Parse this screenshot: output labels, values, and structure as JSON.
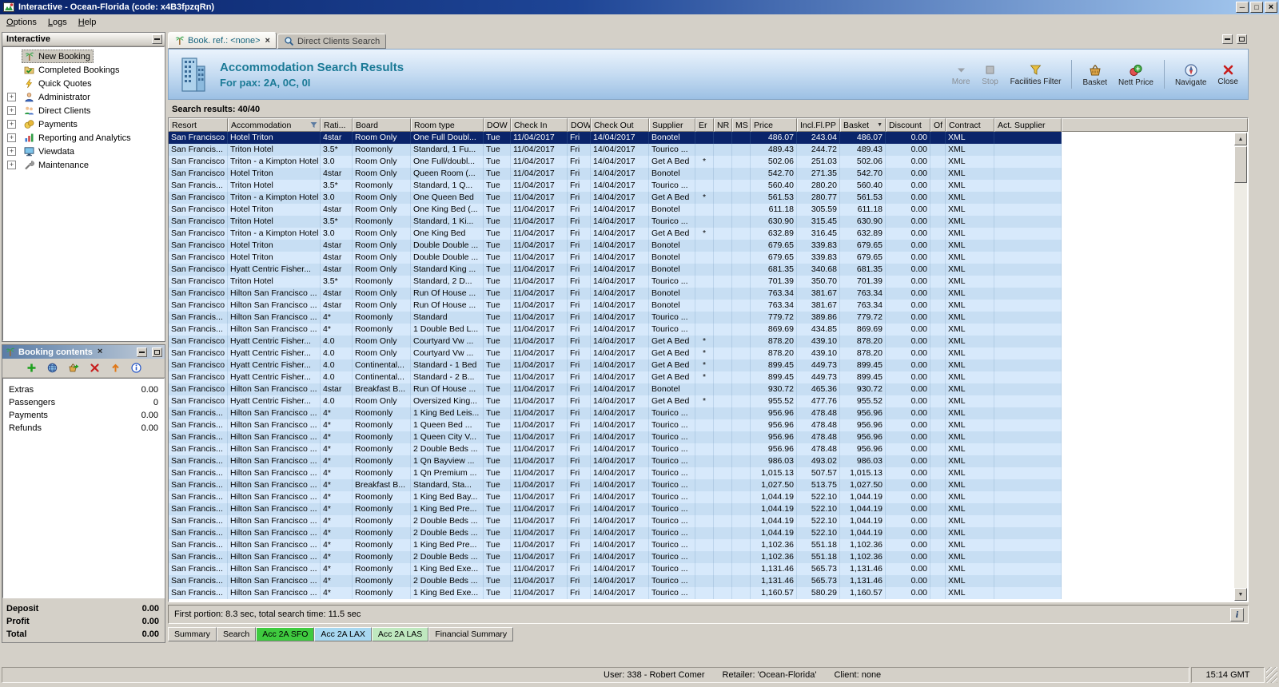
{
  "icons": {
    "minimize": "─",
    "maximize": "□",
    "close": "×",
    "close_small": "×",
    "info": "i",
    "sort_desc": "▼",
    "scroll_up": "▲",
    "scroll_down": "▼",
    "expander_plus": "+"
  },
  "window": {
    "title": "Interactive - Ocean-Florida (code: x4B3fpzqRn)",
    "menu": [
      "Options",
      "Logs",
      "Help"
    ]
  },
  "sidebar": {
    "title": "Interactive",
    "items": [
      {
        "label": "New Booking",
        "icon": "new-booking-icon",
        "selected": true,
        "expandable": false
      },
      {
        "label": "Completed Bookings",
        "icon": "completed-bookings-icon",
        "selected": false,
        "expandable": false
      },
      {
        "label": "Quick Quotes",
        "icon": "quick-quotes-icon",
        "selected": false,
        "expandable": false
      },
      {
        "label": "Administrator",
        "icon": "administrator-icon",
        "selected": false,
        "expandable": true
      },
      {
        "label": "Direct Clients",
        "icon": "direct-clients-icon",
        "selected": false,
        "expandable": true
      },
      {
        "label": "Payments",
        "icon": "payments-icon",
        "selected": false,
        "expandable": true
      },
      {
        "label": "Reporting and Analytics",
        "icon": "reporting-icon",
        "selected": false,
        "expandable": true
      },
      {
        "label": "Viewdata",
        "icon": "viewdata-icon",
        "selected": false,
        "expandable": true
      },
      {
        "label": "Maintenance",
        "icon": "maintenance-icon",
        "selected": false,
        "expandable": true
      }
    ]
  },
  "booking_contents": {
    "title": "Booking contents",
    "toolbar": [
      "add-icon",
      "globe-icon",
      "basket-add-icon",
      "remove-icon",
      "move-up-icon",
      "info-icon"
    ],
    "rows": [
      {
        "label": "Extras",
        "value": "0.00"
      },
      {
        "label": "Passengers",
        "value": "0"
      },
      {
        "label": "Payments",
        "value": "0.00"
      },
      {
        "label": "Refunds",
        "value": "0.00"
      }
    ],
    "totals": [
      {
        "label": "Deposit",
        "value": "0.00"
      },
      {
        "label": "Profit",
        "value": "0.00"
      },
      {
        "label": "Total",
        "value": "0.00"
      }
    ]
  },
  "document_tabs": [
    {
      "label": "Book. ref.: <none>",
      "icon": "palm-tree-icon",
      "active": true,
      "closable": true
    },
    {
      "label": "Direct Clients Search",
      "icon": "client-search-icon",
      "active": false,
      "closable": false
    }
  ],
  "header": {
    "title": "Accommodation Search Results",
    "subtitle": "For pax: 2A, 0C, 0I",
    "accent_color": "#1b7a96",
    "buttons": [
      {
        "label": "More",
        "icon": "more-icon",
        "disabled": true
      },
      {
        "label": "Stop",
        "icon": "stop-icon",
        "disabled": true
      },
      {
        "label": "Facilities Filter",
        "icon": "facilities-filter-icon",
        "disabled": false
      },
      {
        "separator": true
      },
      {
        "label": "Basket",
        "icon": "basket-icon",
        "disabled": false
      },
      {
        "label": "Nett Price",
        "icon": "nett-price-icon",
        "disabled": false
      },
      {
        "separator": true
      },
      {
        "label": "Navigate",
        "icon": "navigate-icon",
        "disabled": false
      },
      {
        "label": "Close",
        "icon": "close-red-icon",
        "disabled": false
      }
    ]
  },
  "results": {
    "summary": "Search results: 40/40",
    "status": "First portion: 8.3 sec, total search time: 11.5 sec",
    "selected_index": 0,
    "sorted_column": "Basket",
    "filtered_column": "Accommodation",
    "selected_row_color": "#0a246a",
    "row_color_a": "#d7e9fb",
    "row_color_b": "#c7def3",
    "columns": [
      "Resort",
      "Accommodation",
      "Rati...",
      "Board",
      "Room type",
      "DOW",
      "Check In",
      "DOW",
      "Check Out",
      "Supplier",
      "Er",
      "NR",
      "MS",
      "Price",
      "Incl.Fl.PP",
      "Basket",
      "Discount",
      "Of",
      "Contract",
      "Act. Supplier"
    ],
    "rows": [
      [
        "San Francisco",
        "Hotel Triton",
        "4star",
        "Room Only",
        "One Full Doubl...",
        "Tue",
        "11/04/2017",
        "Fri",
        "14/04/2017",
        "Bonotel",
        "",
        "",
        "",
        "486.07",
        "243.04",
        "486.07",
        "0.00",
        "",
        "XML",
        ""
      ],
      [
        "San Francis...",
        "Triton Hotel",
        "3.5*",
        "Roomonly",
        "Standard, 1 Fu...",
        "Tue",
        "11/04/2017",
        "Fri",
        "14/04/2017",
        "Tourico ...",
        "",
        "",
        "",
        "489.43",
        "244.72",
        "489.43",
        "0.00",
        "",
        "XML",
        ""
      ],
      [
        "San Francisco",
        "Triton - a Kimpton Hotel",
        "3.0",
        "Room Only",
        "One Full/doubl...",
        "Tue",
        "11/04/2017",
        "Fri",
        "14/04/2017",
        "Get A Bed",
        "*",
        "",
        "",
        "502.06",
        "251.03",
        "502.06",
        "0.00",
        "",
        "XML",
        ""
      ],
      [
        "San Francisco",
        "Hotel Triton",
        "4star",
        "Room Only",
        "Queen Room (...",
        "Tue",
        "11/04/2017",
        "Fri",
        "14/04/2017",
        "Bonotel",
        "",
        "",
        "",
        "542.70",
        "271.35",
        "542.70",
        "0.00",
        "",
        "XML",
        ""
      ],
      [
        "San Francis...",
        "Triton Hotel",
        "3.5*",
        "Roomonly",
        "Standard, 1 Q...",
        "Tue",
        "11/04/2017",
        "Fri",
        "14/04/2017",
        "Tourico ...",
        "",
        "",
        "",
        "560.40",
        "280.20",
        "560.40",
        "0.00",
        "",
        "XML",
        ""
      ],
      [
        "San Francisco",
        "Triton - a Kimpton Hotel",
        "3.0",
        "Room Only",
        "One Queen Bed",
        "Tue",
        "11/04/2017",
        "Fri",
        "14/04/2017",
        "Get A Bed",
        "*",
        "",
        "",
        "561.53",
        "280.77",
        "561.53",
        "0.00",
        "",
        "XML",
        ""
      ],
      [
        "San Francisco",
        "Hotel Triton",
        "4star",
        "Room Only",
        "One King Bed (...",
        "Tue",
        "11/04/2017",
        "Fri",
        "14/04/2017",
        "Bonotel",
        "",
        "",
        "",
        "611.18",
        "305.59",
        "611.18",
        "0.00",
        "",
        "XML",
        ""
      ],
      [
        "San Francisco",
        "Triton Hotel",
        "3.5*",
        "Roomonly",
        "Standard, 1 Ki...",
        "Tue",
        "11/04/2017",
        "Fri",
        "14/04/2017",
        "Tourico ...",
        "",
        "",
        "",
        "630.90",
        "315.45",
        "630.90",
        "0.00",
        "",
        "XML",
        ""
      ],
      [
        "San Francisco",
        "Triton - a Kimpton Hotel",
        "3.0",
        "Room Only",
        "One King Bed",
        "Tue",
        "11/04/2017",
        "Fri",
        "14/04/2017",
        "Get A Bed",
        "*",
        "",
        "",
        "632.89",
        "316.45",
        "632.89",
        "0.00",
        "",
        "XML",
        ""
      ],
      [
        "San Francisco",
        "Hotel Triton",
        "4star",
        "Room Only",
        "Double Double ...",
        "Tue",
        "11/04/2017",
        "Fri",
        "14/04/2017",
        "Bonotel",
        "",
        "",
        "",
        "679.65",
        "339.83",
        "679.65",
        "0.00",
        "",
        "XML",
        ""
      ],
      [
        "San Francisco",
        "Hotel Triton",
        "4star",
        "Room Only",
        "Double Double ...",
        "Tue",
        "11/04/2017",
        "Fri",
        "14/04/2017",
        "Bonotel",
        "",
        "",
        "",
        "679.65",
        "339.83",
        "679.65",
        "0.00",
        "",
        "XML",
        ""
      ],
      [
        "San Francisco",
        "Hyatt Centric Fisher...",
        "4star",
        "Room Only",
        "Standard King ...",
        "Tue",
        "11/04/2017",
        "Fri",
        "14/04/2017",
        "Bonotel",
        "",
        "",
        "",
        "681.35",
        "340.68",
        "681.35",
        "0.00",
        "",
        "XML",
        ""
      ],
      [
        "San Francisco",
        "Triton Hotel",
        "3.5*",
        "Roomonly",
        "Standard, 2 D...",
        "Tue",
        "11/04/2017",
        "Fri",
        "14/04/2017",
        "Tourico ...",
        "",
        "",
        "",
        "701.39",
        "350.70",
        "701.39",
        "0.00",
        "",
        "XML",
        ""
      ],
      [
        "San Francisco",
        "Hilton San Francisco ...",
        "4star",
        "Room Only",
        "Run Of House ...",
        "Tue",
        "11/04/2017",
        "Fri",
        "14/04/2017",
        "Bonotel",
        "",
        "",
        "",
        "763.34",
        "381.67",
        "763.34",
        "0.00",
        "",
        "XML",
        ""
      ],
      [
        "San Francisco",
        "Hilton San Francisco ...",
        "4star",
        "Room Only",
        "Run Of House ...",
        "Tue",
        "11/04/2017",
        "Fri",
        "14/04/2017",
        "Bonotel",
        "",
        "",
        "",
        "763.34",
        "381.67",
        "763.34",
        "0.00",
        "",
        "XML",
        ""
      ],
      [
        "San Francis...",
        "Hilton San Francisco ...",
        "4*",
        "Roomonly",
        "Standard",
        "Tue",
        "11/04/2017",
        "Fri",
        "14/04/2017",
        "Tourico ...",
        "",
        "",
        "",
        "779.72",
        "389.86",
        "779.72",
        "0.00",
        "",
        "XML",
        ""
      ],
      [
        "San Francis...",
        "Hilton San Francisco ...",
        "4*",
        "Roomonly",
        "1 Double Bed L...",
        "Tue",
        "11/04/2017",
        "Fri",
        "14/04/2017",
        "Tourico ...",
        "",
        "",
        "",
        "869.69",
        "434.85",
        "869.69",
        "0.00",
        "",
        "XML",
        ""
      ],
      [
        "San Francisco",
        "Hyatt Centric Fisher...",
        "4.0",
        "Room Only",
        "Courtyard Vw ...",
        "Tue",
        "11/04/2017",
        "Fri",
        "14/04/2017",
        "Get A Bed",
        "*",
        "",
        "",
        "878.20",
        "439.10",
        "878.20",
        "0.00",
        "",
        "XML",
        ""
      ],
      [
        "San Francisco",
        "Hyatt Centric Fisher...",
        "4.0",
        "Room Only",
        "Courtyard Vw ...",
        "Tue",
        "11/04/2017",
        "Fri",
        "14/04/2017",
        "Get A Bed",
        "*",
        "",
        "",
        "878.20",
        "439.10",
        "878.20",
        "0.00",
        "",
        "XML",
        ""
      ],
      [
        "San Francisco",
        "Hyatt Centric Fisher...",
        "4.0",
        "Continental...",
        "Standard - 1 Bed",
        "Tue",
        "11/04/2017",
        "Fri",
        "14/04/2017",
        "Get A Bed",
        "*",
        "",
        "",
        "899.45",
        "449.73",
        "899.45",
        "0.00",
        "",
        "XML",
        ""
      ],
      [
        "San Francisco",
        "Hyatt Centric Fisher...",
        "4.0",
        "Continental...",
        "Standard - 2 B...",
        "Tue",
        "11/04/2017",
        "Fri",
        "14/04/2017",
        "Get A Bed",
        "*",
        "",
        "",
        "899.45",
        "449.73",
        "899.45",
        "0.00",
        "",
        "XML",
        ""
      ],
      [
        "San Francisco",
        "Hilton San Francisco ...",
        "4star",
        "Breakfast B...",
        "Run Of House ...",
        "Tue",
        "11/04/2017",
        "Fri",
        "14/04/2017",
        "Bonotel",
        "",
        "",
        "",
        "930.72",
        "465.36",
        "930.72",
        "0.00",
        "",
        "XML",
        ""
      ],
      [
        "San Francisco",
        "Hyatt Centric Fisher...",
        "4.0",
        "Room Only",
        "Oversized King...",
        "Tue",
        "11/04/2017",
        "Fri",
        "14/04/2017",
        "Get A Bed",
        "*",
        "",
        "",
        "955.52",
        "477.76",
        "955.52",
        "0.00",
        "",
        "XML",
        ""
      ],
      [
        "San Francis...",
        "Hilton San Francisco ...",
        "4*",
        "Roomonly",
        "1 King Bed Leis...",
        "Tue",
        "11/04/2017",
        "Fri",
        "14/04/2017",
        "Tourico ...",
        "",
        "",
        "",
        "956.96",
        "478.48",
        "956.96",
        "0.00",
        "",
        "XML",
        ""
      ],
      [
        "San Francis...",
        "Hilton San Francisco ...",
        "4*",
        "Roomonly",
        "1 Queen Bed ...",
        "Tue",
        "11/04/2017",
        "Fri",
        "14/04/2017",
        "Tourico ...",
        "",
        "",
        "",
        "956.96",
        "478.48",
        "956.96",
        "0.00",
        "",
        "XML",
        ""
      ],
      [
        "San Francis...",
        "Hilton San Francisco ...",
        "4*",
        "Roomonly",
        "1 Queen City V...",
        "Tue",
        "11/04/2017",
        "Fri",
        "14/04/2017",
        "Tourico ...",
        "",
        "",
        "",
        "956.96",
        "478.48",
        "956.96",
        "0.00",
        "",
        "XML",
        ""
      ],
      [
        "San Francis...",
        "Hilton San Francisco ...",
        "4*",
        "Roomonly",
        "2 Double Beds ...",
        "Tue",
        "11/04/2017",
        "Fri",
        "14/04/2017",
        "Tourico ...",
        "",
        "",
        "",
        "956.96",
        "478.48",
        "956.96",
        "0.00",
        "",
        "XML",
        ""
      ],
      [
        "San Francis...",
        "Hilton San Francisco ...",
        "4*",
        "Roomonly",
        "1 Qn Bayview ...",
        "Tue",
        "11/04/2017",
        "Fri",
        "14/04/2017",
        "Tourico ...",
        "",
        "",
        "",
        "986.03",
        "493.02",
        "986.03",
        "0.00",
        "",
        "XML",
        ""
      ],
      [
        "San Francis...",
        "Hilton San Francisco ...",
        "4*",
        "Roomonly",
        "1 Qn Premium ...",
        "Tue",
        "11/04/2017",
        "Fri",
        "14/04/2017",
        "Tourico ...",
        "",
        "",
        "",
        "1,015.13",
        "507.57",
        "1,015.13",
        "0.00",
        "",
        "XML",
        ""
      ],
      [
        "San Francis...",
        "Hilton San Francisco ...",
        "4*",
        "Breakfast B...",
        "Standard, Sta...",
        "Tue",
        "11/04/2017",
        "Fri",
        "14/04/2017",
        "Tourico ...",
        "",
        "",
        "",
        "1,027.50",
        "513.75",
        "1,027.50",
        "0.00",
        "",
        "XML",
        ""
      ],
      [
        "San Francis...",
        "Hilton San Francisco ...",
        "4*",
        "Roomonly",
        "1 King Bed Bay...",
        "Tue",
        "11/04/2017",
        "Fri",
        "14/04/2017",
        "Tourico ...",
        "",
        "",
        "",
        "1,044.19",
        "522.10",
        "1,044.19",
        "0.00",
        "",
        "XML",
        ""
      ],
      [
        "San Francis...",
        "Hilton San Francisco ...",
        "4*",
        "Roomonly",
        "1 King Bed Pre...",
        "Tue",
        "11/04/2017",
        "Fri",
        "14/04/2017",
        "Tourico ...",
        "",
        "",
        "",
        "1,044.19",
        "522.10",
        "1,044.19",
        "0.00",
        "",
        "XML",
        ""
      ],
      [
        "San Francis...",
        "Hilton San Francisco ...",
        "4*",
        "Roomonly",
        "2 Double Beds ...",
        "Tue",
        "11/04/2017",
        "Fri",
        "14/04/2017",
        "Tourico ...",
        "",
        "",
        "",
        "1,044.19",
        "522.10",
        "1,044.19",
        "0.00",
        "",
        "XML",
        ""
      ],
      [
        "San Francis...",
        "Hilton San Francisco ...",
        "4*",
        "Roomonly",
        "2 Double Beds ...",
        "Tue",
        "11/04/2017",
        "Fri",
        "14/04/2017",
        "Tourico ...",
        "",
        "",
        "",
        "1,044.19",
        "522.10",
        "1,044.19",
        "0.00",
        "",
        "XML",
        ""
      ],
      [
        "San Francis...",
        "Hilton San Francisco ...",
        "4*",
        "Roomonly",
        "1 King Bed Pre...",
        "Tue",
        "11/04/2017",
        "Fri",
        "14/04/2017",
        "Tourico ...",
        "",
        "",
        "",
        "1,102.36",
        "551.18",
        "1,102.36",
        "0.00",
        "",
        "XML",
        ""
      ],
      [
        "San Francis...",
        "Hilton San Francisco ...",
        "4*",
        "Roomonly",
        "2 Double Beds ...",
        "Tue",
        "11/04/2017",
        "Fri",
        "14/04/2017",
        "Tourico ...",
        "",
        "",
        "",
        "1,102.36",
        "551.18",
        "1,102.36",
        "0.00",
        "",
        "XML",
        ""
      ],
      [
        "San Francis...",
        "Hilton San Francisco ...",
        "4*",
        "Roomonly",
        "1 King Bed Exe...",
        "Tue",
        "11/04/2017",
        "Fri",
        "14/04/2017",
        "Tourico ...",
        "",
        "",
        "",
        "1,131.46",
        "565.73",
        "1,131.46",
        "0.00",
        "",
        "XML",
        ""
      ],
      [
        "San Francis...",
        "Hilton San Francisco ...",
        "4*",
        "Roomonly",
        "2 Double Beds ...",
        "Tue",
        "11/04/2017",
        "Fri",
        "14/04/2017",
        "Tourico ...",
        "",
        "",
        "",
        "1,131.46",
        "565.73",
        "1,131.46",
        "0.00",
        "",
        "XML",
        ""
      ],
      [
        "San Francis...",
        "Hilton San Francisco ...",
        "4*",
        "Roomonly",
        "1 King Bed Exe...",
        "Tue",
        "11/04/2017",
        "Fri",
        "14/04/2017",
        "Tourico ...",
        "",
        "",
        "",
        "1,160.57",
        "580.29",
        "1,160.57",
        "0.00",
        "",
        "XML",
        ""
      ]
    ]
  },
  "bottom_tabs": [
    {
      "label": "Summary",
      "color": null,
      "active": false
    },
    {
      "label": "Search",
      "color": null,
      "active": false
    },
    {
      "label": "Acc 2A SFO",
      "color": "#3fca3f",
      "active": true
    },
    {
      "label": "Acc 2A LAX",
      "color": "#a8d8f0",
      "active": false
    },
    {
      "label": "Acc 2A LAS",
      "color": "#bfe8bf",
      "active": false
    },
    {
      "label": "Financial Summary",
      "color": null,
      "active": false
    }
  ],
  "statusbar": {
    "user": "User: 338 - Robert Comer",
    "retailer": "Retailer: 'Ocean-Florida'",
    "client": "Client: none",
    "time": "15:14 GMT"
  }
}
